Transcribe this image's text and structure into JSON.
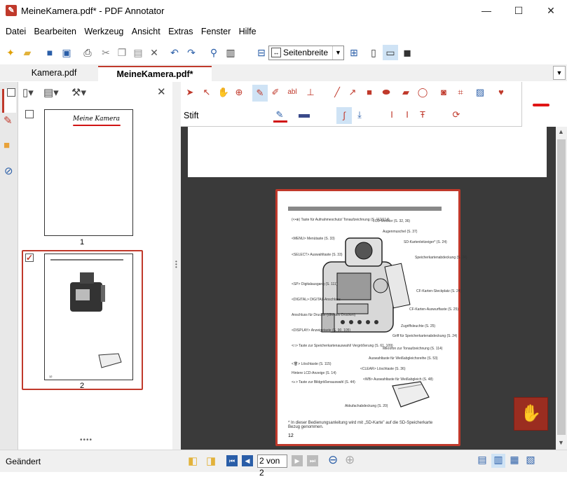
{
  "window": {
    "title": "MeineKamera.pdf* - PDF Annotator",
    "app_icon": "pdf-annotator-icon"
  },
  "menu": [
    "Datei",
    "Bearbeiten",
    "Werkzeug",
    "Ansicht",
    "Extras",
    "Fenster",
    "Hilfe"
  ],
  "toolbar": {
    "zoom_value": "Seitenbreite"
  },
  "tabs": [
    {
      "label": "Kamera.pdf",
      "active": false
    },
    {
      "label": "MeineKamera.pdf*",
      "active": true
    }
  ],
  "thumbnails": [
    {
      "number": "1",
      "title": "Meine Kamera",
      "checked": false
    },
    {
      "number": "2",
      "checked": true
    }
  ],
  "tool": {
    "name": "Stift",
    "pen_color": "#d11414",
    "accent": "#c0392b"
  },
  "page2": {
    "page_number": "12",
    "footnote": "* In dieser Bedienungsanleitung wird mit „SD-Karte\" auf die SD-Speicherkarte Bezug genommen.",
    "labels_left": [
      "(<•⊕) Taste für Aufnahmeschutz/ Tonaufzeichnung (S. 112/114)",
      "<MENU> Menütaste (S. 33)",
      "<SELECT> Auswahltaste (S. 33)",
      "<SP> Digitalausgang (S. 111)",
      "<DIGITAL> DIGITAL-Anschluss",
      "Anschluss für Drucker (direktes Drucken)",
      "<DISPLAY> Anzeigetaste (S. 90, 105)",
      "<□> Taste zur Speicherkartenauswahl/ Vergrößerung (S. 61, 109)",
      "<🗑> Löschtaste (S. 115)",
      "Hintere LCD-Anzeige (S. 14)",
      "<◐> Taste zur Bildgrößenauswahl (S. 44)"
    ],
    "labels_right": [
      "LCD-Monitor (S. 32, 36)",
      "Augenmuschel (S. 37)",
      "SD-Kartenleitzeiger* (S. 24)",
      "Speicherkartenabdeckung (S. 24)",
      "CF-Karten-Steckplatz (S. 24)",
      "CF-Karten-Auswurftaste (S. 25)",
      "Zugriffsleuchte (S. 25)",
      "Griff für Speicherkartenabdeckung (S. 24)",
      "Mikrofon zur Tonaufzeichnung (S. 114)",
      "Auswahltaste für Weißabgleichsreihe (S. 53)",
      "<CLEAR> Löschtaste (S. 36)",
      "<WB> Auswahltaste für Weißabgleich (S. 48)",
      "Akkufachabdeckung (S. 20)"
    ]
  },
  "status": {
    "text": "Geändert",
    "page_indicator": "2 von 2"
  }
}
